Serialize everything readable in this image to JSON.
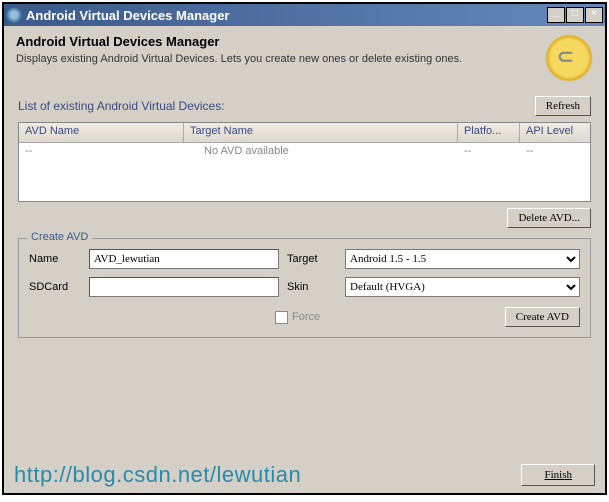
{
  "titlebar": {
    "text": "Android Virtual Devices Manager"
  },
  "header": {
    "title": "Android Virtual Devices Manager",
    "description": "Displays existing Android Virtual Devices. Lets you create new ones or delete existing ones."
  },
  "list": {
    "label": "List of existing Android Virtual Devices:",
    "refresh": "Refresh",
    "columns": {
      "avd_name": "AVD Name",
      "target_name": "Target Name",
      "platform": "Platfo...",
      "api_level": "API Level"
    },
    "empty_row": {
      "avd": "--",
      "target": "No AVD available",
      "platform": "--",
      "api": "--"
    },
    "delete": "Delete AVD..."
  },
  "create": {
    "legend": "Create AVD",
    "name_label": "Name",
    "name_value": "AVD_lewutian",
    "sdcard_label": "SDCard",
    "sdcard_value": "",
    "target_label": "Target",
    "target_value": "Android 1.5 - 1.5",
    "skin_label": "Skin",
    "skin_value": "Default (HVGA)",
    "force_label": "Force",
    "create_btn": "Create AVD"
  },
  "footer": {
    "watermark": "http://blog.csdn.net/lewutian",
    "finish": "Finish"
  }
}
